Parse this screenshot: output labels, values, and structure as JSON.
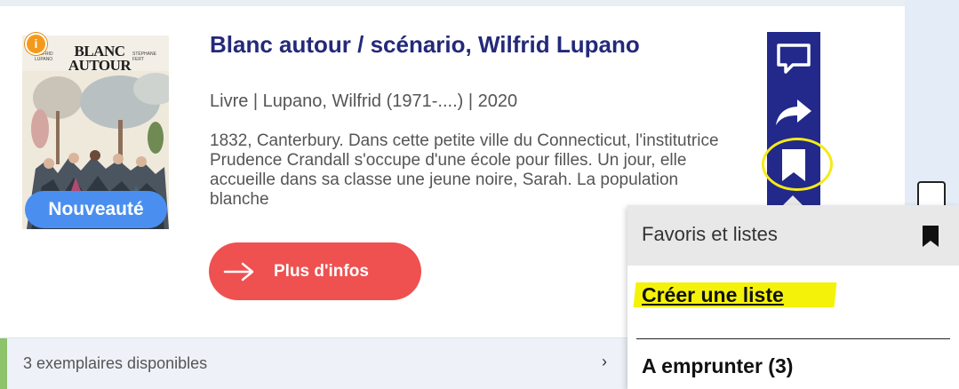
{
  "cover": {
    "title_line1": "BLANC",
    "title_line2": "AUTOUR",
    "author_left": "WILFRID LUPANO",
    "author_right": "STÉPHANE FERT",
    "badge": "Nouveauté",
    "info_icon": "info-icon"
  },
  "record": {
    "title": "Blanc autour / scénario, Wilfrid Lupano",
    "meta": "Livre | Lupano, Wilfrid (1971-....) | 2020",
    "summary": "1832, Canterbury. Dans cette petite ville du Connecticut, l'institutrice Prudence Crandall s'occupe d'une école pour filles. Un jour, elle accueille dans sa classe une jeune noire, Sarah. La population blanche",
    "more_button": "Plus d'infos"
  },
  "actions": {
    "comment_icon": "comment-icon",
    "share_icon": "share-icon",
    "bookmark_icon": "bookmark-icon"
  },
  "favorites_menu": {
    "title": "Favoris et listes",
    "create_list": "Créer une liste",
    "borrow": "A emprunter (3)"
  },
  "availability": {
    "text": "3 exemplaires disponibles",
    "chevron": "›"
  },
  "colors": {
    "title": "#24297a",
    "action_bar": "#22298a",
    "more_button": "#ee5150",
    "badge": "#4a8ff0",
    "highlight": "#f6ea16",
    "available_accent": "#8dc36a"
  }
}
